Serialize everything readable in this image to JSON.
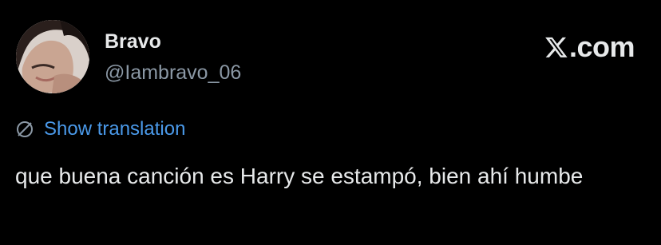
{
  "author": {
    "name": "Bravo",
    "handle": "@Iambravo_06",
    "avatar_icon": "profile-photo"
  },
  "brand": {
    "label": ".com",
    "icon": "x-logo-icon"
  },
  "translation": {
    "icon": "translate-icon",
    "label": "Show translation",
    "color": "#4a99e9"
  },
  "tweet": {
    "text": "que buena canción es Harry se estampó, bien ahí humbe"
  },
  "colors": {
    "background": "#000000",
    "text": "#e7e9ea",
    "muted": "#8b98a5",
    "link": "#4a99e9"
  }
}
